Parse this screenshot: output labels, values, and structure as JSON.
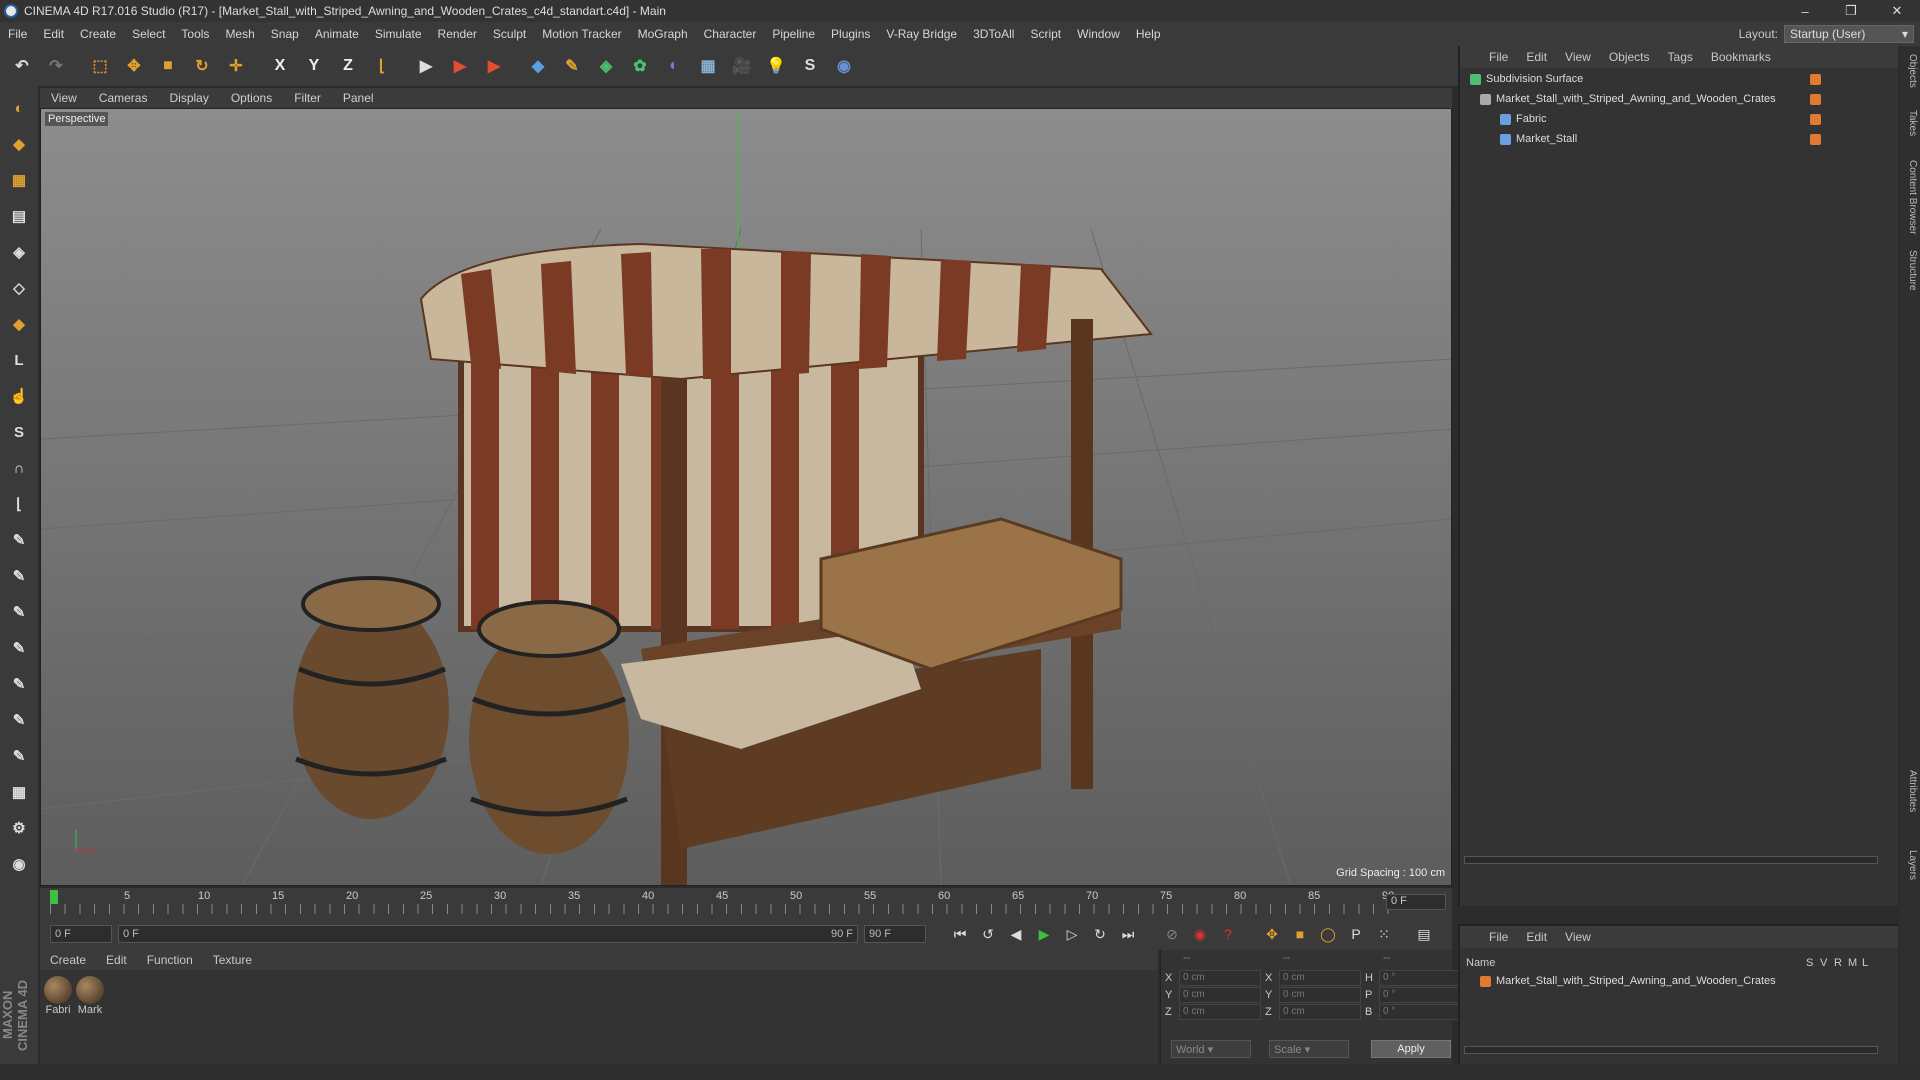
{
  "window": {
    "title": "CINEMA 4D R17.016 Studio (R17) - [Market_Stall_with_Striped_Awning_and_Wooden_Crates_c4d_standart.c4d] - Main",
    "controls": [
      "–",
      "❐",
      "✕"
    ]
  },
  "menubar": [
    "File",
    "Edit",
    "Create",
    "Select",
    "Tools",
    "Mesh",
    "Snap",
    "Animate",
    "Simulate",
    "Render",
    "Sculpt",
    "Motion Tracker",
    "MoGraph",
    "Character",
    "Pipeline",
    "Plugins",
    "V-Ray Bridge",
    "3DToAll",
    "Script",
    "Window",
    "Help"
  ],
  "layout": {
    "label": "Layout:",
    "value": "Startup (User)"
  },
  "toolbar": [
    {
      "name": "undo-icon",
      "glyph": "↶",
      "color": "#ddd"
    },
    {
      "name": "redo-icon",
      "glyph": "↷",
      "color": "#777"
    },
    {
      "name": "live-selection-icon",
      "glyph": "⬚",
      "color": "#e08a2e"
    },
    {
      "name": "move-icon",
      "glyph": "✥",
      "color": "#e0a030"
    },
    {
      "name": "scale-icon",
      "glyph": "■",
      "color": "#e0a030"
    },
    {
      "name": "rotate-icon",
      "glyph": "↻",
      "color": "#e0a030"
    },
    {
      "name": "transform-icon",
      "glyph": "✛",
      "color": "#e0a030"
    },
    {
      "name": "x-axis-icon",
      "glyph": "X",
      "color": "#eee"
    },
    {
      "name": "y-axis-icon",
      "glyph": "Y",
      "color": "#eee"
    },
    {
      "name": "z-axis-icon",
      "glyph": "Z",
      "color": "#eee"
    },
    {
      "name": "coord-system-icon",
      "glyph": "⌊",
      "color": "#e0a030"
    },
    {
      "name": "render-view-icon",
      "glyph": "▶",
      "color": "#ddd"
    },
    {
      "name": "render-picture-viewer-icon",
      "glyph": "▶",
      "color": "#e05030"
    },
    {
      "name": "render-settings-icon",
      "glyph": "▶",
      "color": "#e05030"
    },
    {
      "name": "cube-icon",
      "glyph": "◆",
      "color": "#5aa0e0"
    },
    {
      "name": "pen-icon",
      "glyph": "✎",
      "color": "#e0a030"
    },
    {
      "name": "subdivision-icon",
      "glyph": "◈",
      "color": "#4ac070"
    },
    {
      "name": "mograph-cloner-icon",
      "glyph": "✿",
      "color": "#4ac070"
    },
    {
      "name": "deformer-icon",
      "glyph": "◐",
      "color": "#6a80e0"
    },
    {
      "name": "floor-icon",
      "glyph": "▦",
      "color": "#8ab0d0"
    },
    {
      "name": "camera-icon",
      "glyph": "🎥",
      "color": "#ddd"
    },
    {
      "name": "light-icon",
      "glyph": "💡",
      "color": "#ddd"
    },
    {
      "name": "sketch-icon",
      "glyph": "S",
      "color": "#ddd"
    },
    {
      "name": "python-icon",
      "glyph": "◉",
      "color": "#6a90d0"
    }
  ],
  "lefttools": [
    {
      "name": "model-mode-icon",
      "glyph": "◐"
    },
    {
      "name": "object-mode-icon",
      "glyph": "◆"
    },
    {
      "name": "texture-mode-icon",
      "glyph": "▦"
    },
    {
      "name": "workplane-icon",
      "glyph": "▤"
    },
    {
      "name": "points-mode-icon",
      "glyph": "◈"
    },
    {
      "name": "edges-mode-icon",
      "glyph": "◇"
    },
    {
      "name": "polygons-mode-icon",
      "glyph": "◆"
    },
    {
      "name": "axis-mode-icon",
      "glyph": "L"
    },
    {
      "name": "tweak-icon",
      "glyph": "☝"
    },
    {
      "name": "snap-icon",
      "glyph": "S"
    },
    {
      "name": "magnet-icon",
      "glyph": "∩"
    },
    {
      "name": "quantize-icon",
      "glyph": "⌊"
    },
    {
      "name": "brush-1-icon",
      "glyph": "✎"
    },
    {
      "name": "brush-2-icon",
      "glyph": "✎"
    },
    {
      "name": "brush-3-icon",
      "glyph": "✎"
    },
    {
      "name": "brush-4-icon",
      "glyph": "✎"
    },
    {
      "name": "brush-5-icon",
      "glyph": "✎"
    },
    {
      "name": "brush-6-icon",
      "glyph": "✎"
    },
    {
      "name": "brush-7-icon",
      "glyph": "✎"
    },
    {
      "name": "grid-lock-icon",
      "glyph": "▦"
    },
    {
      "name": "gear-icon",
      "glyph": "⚙"
    },
    {
      "name": "python-script-icon",
      "glyph": "◉"
    }
  ],
  "viewport": {
    "menu": [
      "View",
      "Cameras",
      "Display",
      "Options",
      "Filter",
      "Panel"
    ],
    "label": "Perspective",
    "grid_spacing": "Grid Spacing : 100 cm"
  },
  "timeline": {
    "ticks": [
      "0",
      "5",
      "10",
      "15",
      "20",
      "25",
      "30",
      "35",
      "40",
      "45",
      "50",
      "55",
      "60",
      "65",
      "70",
      "75",
      "80",
      "85",
      "90"
    ],
    "current": "0 F"
  },
  "transport": {
    "start": "0 F",
    "range_start": "0 F",
    "range_end": "90 F",
    "end": "90 F"
  },
  "materials": {
    "menu": [
      "Create",
      "Edit",
      "Function",
      "Texture"
    ],
    "items": [
      "Fabri",
      "Mark"
    ]
  },
  "coords": {
    "headers": [
      "--",
      "--",
      "--"
    ],
    "rows": [
      {
        "a": "X",
        "av": "0 cm",
        "b": "X",
        "bv": "0 cm",
        "c": "H",
        "cv": "0 °"
      },
      {
        "a": "Y",
        "av": "0 cm",
        "b": "Y",
        "bv": "0 cm",
        "c": "P",
        "cv": "0 °"
      },
      {
        "a": "Z",
        "av": "0 cm",
        "b": "Z",
        "bv": "0 cm",
        "c": "B",
        "cv": "0 °"
      }
    ],
    "space": "World",
    "mode": "Scale",
    "apply": "Apply"
  },
  "objects": {
    "menu": [
      "File",
      "Edit",
      "View",
      "Objects",
      "Tags",
      "Bookmarks"
    ],
    "items": [
      {
        "name": "Subdivision Surface",
        "color": "#4ac070"
      },
      {
        "name": "Market_Stall_with_Striped_Awning_and_Wooden_Crates",
        "color": "#aaa"
      },
      {
        "name": "Fabric",
        "color": "#6aa0e0"
      },
      {
        "name": "Market_Stall",
        "color": "#6aa0e0"
      }
    ]
  },
  "layers": {
    "menu": [
      "File",
      "Edit",
      "View"
    ],
    "header": {
      "name": "Name",
      "cols": [
        "S",
        "V",
        "R",
        "M",
        "L"
      ]
    },
    "item": "Market_Stall_with_Striped_Awning_and_Wooden_Crates"
  },
  "sidetabs": [
    "Objects",
    "Takes",
    "Content Browser",
    "Structure",
    "Attributes",
    "Layers"
  ],
  "brand": "MAXON CINEMA 4D"
}
